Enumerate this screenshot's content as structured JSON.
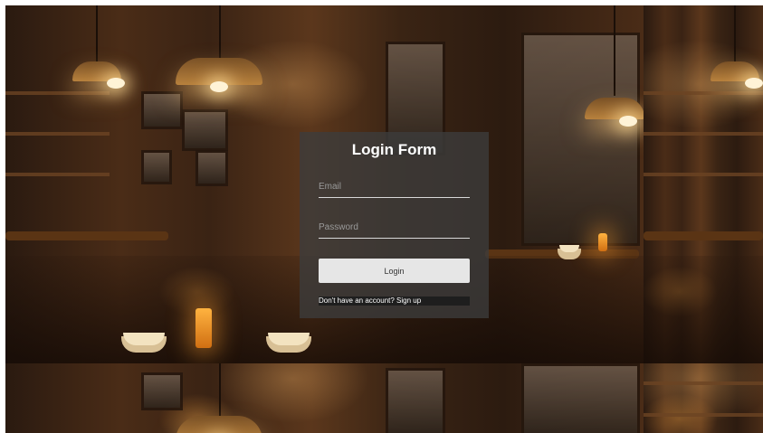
{
  "login_form": {
    "title": "Login Form",
    "email_placeholder": "Email",
    "password_placeholder": "Password",
    "login_label": "Login",
    "signup_prompt": "Don't have an account?",
    "signup_link": "Sign up"
  },
  "background": {
    "description": "tiled-cafe-interior",
    "accent_color": "#d9a05a"
  },
  "colors": {
    "card_bg": "#3c3c3c",
    "button_bg": "#e6e6e6",
    "text": "#ffffff"
  }
}
